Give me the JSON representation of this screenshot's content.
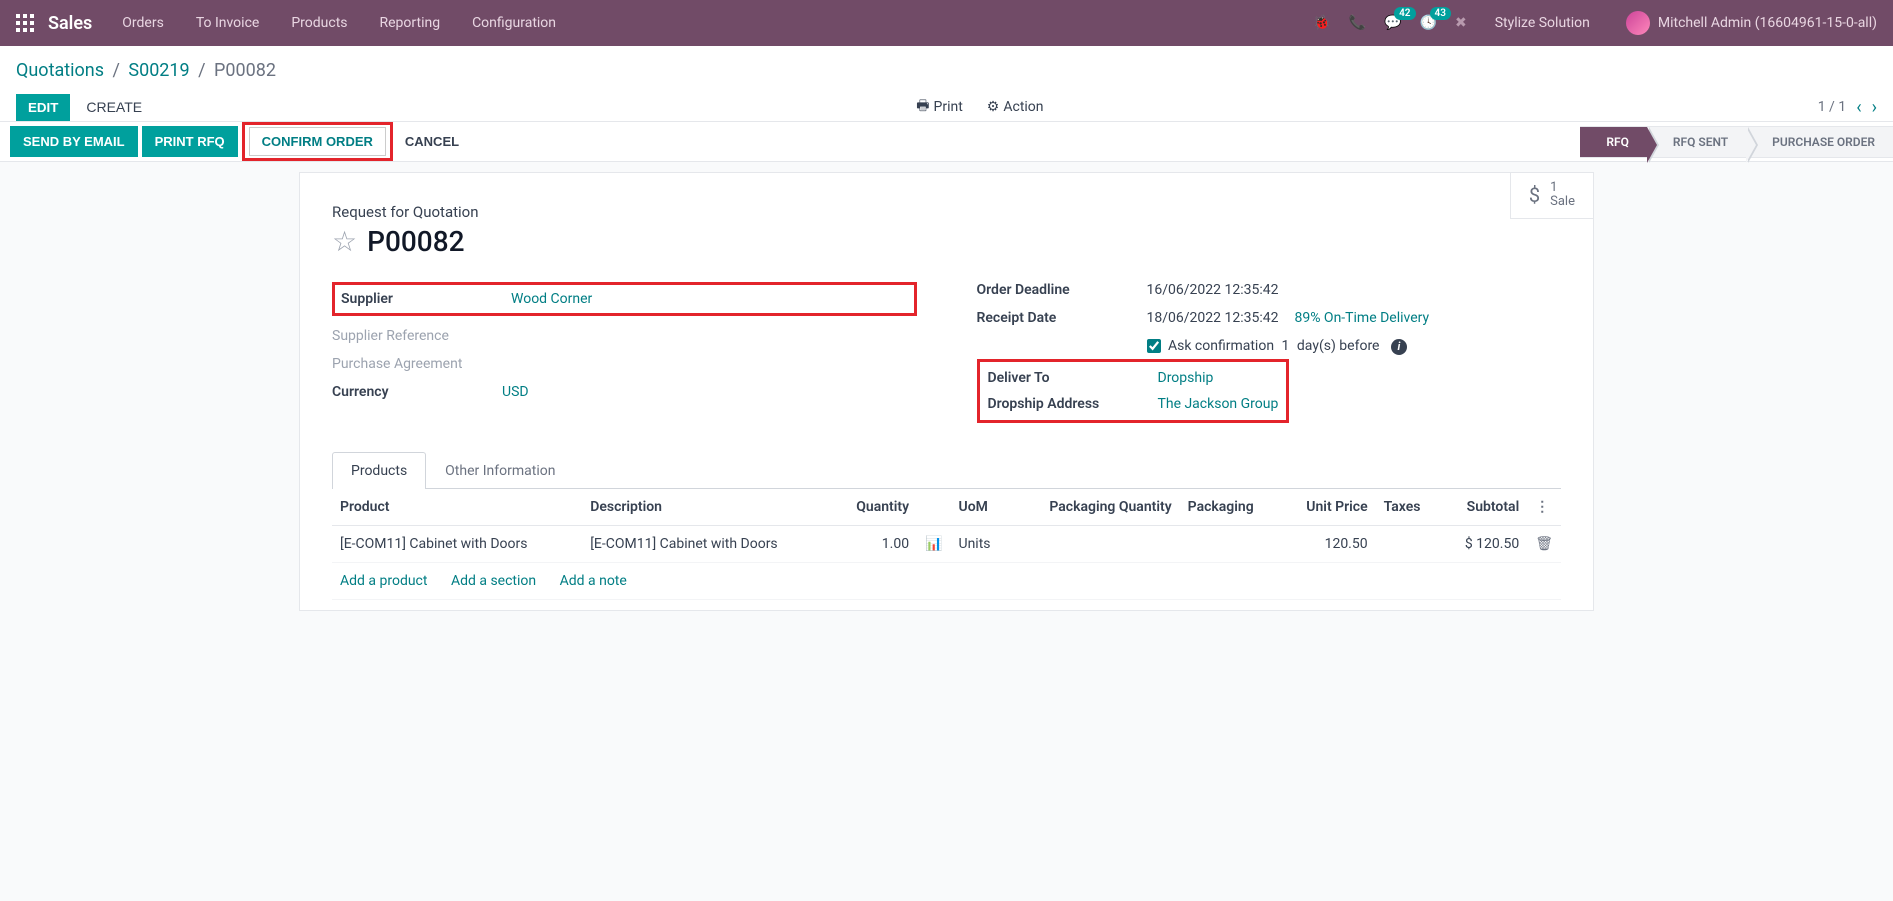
{
  "topnav": {
    "brand": "Sales",
    "links": [
      "Orders",
      "To Invoice",
      "Products",
      "Reporting",
      "Configuration"
    ],
    "msg_badge": "42",
    "activity_badge": "43",
    "company": "Stylize Solution",
    "user": "Mitchell Admin (16604961-15-0-all)"
  },
  "breadcrumb": {
    "root": "Quotations",
    "mid": "S00219",
    "current": "P00082"
  },
  "controls": {
    "edit": "EDIT",
    "create": "CREATE",
    "print": "Print",
    "action": "Action",
    "pager": "1 / 1"
  },
  "statusbar": {
    "send": "SEND BY EMAIL",
    "printrfq": "PRINT RFQ",
    "confirm": "CONFIRM ORDER",
    "cancel": "CANCEL",
    "steps": [
      "RFQ",
      "RFQ SENT",
      "PURCHASE ORDER"
    ]
  },
  "statbtn": {
    "count": "1",
    "label": "Sale"
  },
  "header": {
    "subtitle": "Request for Quotation",
    "name": "P00082"
  },
  "left_fields": {
    "supplier_label": "Supplier",
    "supplier_value": "Wood Corner",
    "supplier_ref_label": "Supplier Reference",
    "purchase_agreement_label": "Purchase Agreement",
    "currency_label": "Currency",
    "currency_value": "USD"
  },
  "right_fields": {
    "order_deadline_label": "Order Deadline",
    "order_deadline_value": "16/06/2022 12:35:42",
    "receipt_date_label": "Receipt Date",
    "receipt_date_value": "18/06/2022 12:35:42",
    "on_time_delivery": "89% On-Time Delivery",
    "ask_confirm_prefix": "Ask confirmation",
    "ask_confirm_days": "1",
    "ask_confirm_suffix": "day(s) before",
    "deliver_to_label": "Deliver To",
    "deliver_to_value": "Dropship",
    "dropship_label": "Dropship Address",
    "dropship_value": "The Jackson Group"
  },
  "tabs": {
    "products": "Products",
    "other": "Other Information"
  },
  "table": {
    "cols": {
      "product": "Product",
      "description": "Description",
      "quantity": "Quantity",
      "uom": "UoM",
      "pack_qty": "Packaging Quantity",
      "packaging": "Packaging",
      "unit_price": "Unit Price",
      "taxes": "Taxes",
      "subtotal": "Subtotal"
    },
    "rows": [
      {
        "product": "[E-COM11] Cabinet with Doors",
        "description": "[E-COM11] Cabinet with Doors",
        "quantity": "1.00",
        "uom": "Units",
        "pack_qty": "",
        "packaging": "",
        "unit_price": "120.50",
        "taxes": "",
        "subtotal": "$ 120.50"
      }
    ],
    "add_product": "Add a product",
    "add_section": "Add a section",
    "add_note": "Add a note"
  }
}
